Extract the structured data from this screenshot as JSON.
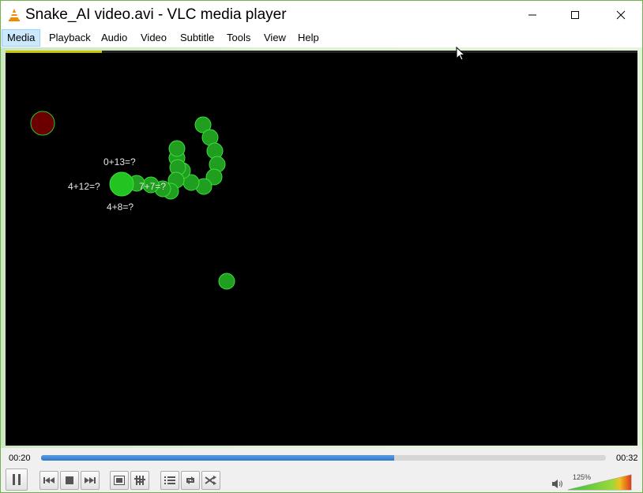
{
  "window": {
    "title": "Snake_AI video.avi - VLC media player"
  },
  "menu": {
    "items": [
      {
        "label": "Media"
      },
      {
        "label": "Playback"
      },
      {
        "label": "Audio"
      },
      {
        "label": "Video"
      },
      {
        "label": "Subtitle"
      },
      {
        "label": "Tools"
      },
      {
        "label": "View"
      },
      {
        "label": "Help"
      }
    ]
  },
  "video": {
    "labels": [
      {
        "text": "0+13=?"
      },
      {
        "text": "4+12=?"
      },
      {
        "text": "7+7=?"
      },
      {
        "text": "4+8=?"
      }
    ],
    "colors": {
      "snake": "#2db82d",
      "snake_head": "#22c422",
      "food": "#6b0000",
      "pellet": "#1f9e1f"
    }
  },
  "playback": {
    "elapsed": "00:20",
    "total": "00:32",
    "progress": 0.625
  },
  "controls": {
    "icons": [
      "pause-icon",
      "previous-icon",
      "stop-icon",
      "next-icon",
      "fullscreen-icon",
      "extended-settings-icon",
      "playlist-icon",
      "loop-icon",
      "shuffle-icon"
    ]
  },
  "volume": {
    "percent_label": "125%",
    "level": 1.25
  },
  "colors": {
    "accent": "#2d76c8",
    "border": "#6fb44a"
  }
}
